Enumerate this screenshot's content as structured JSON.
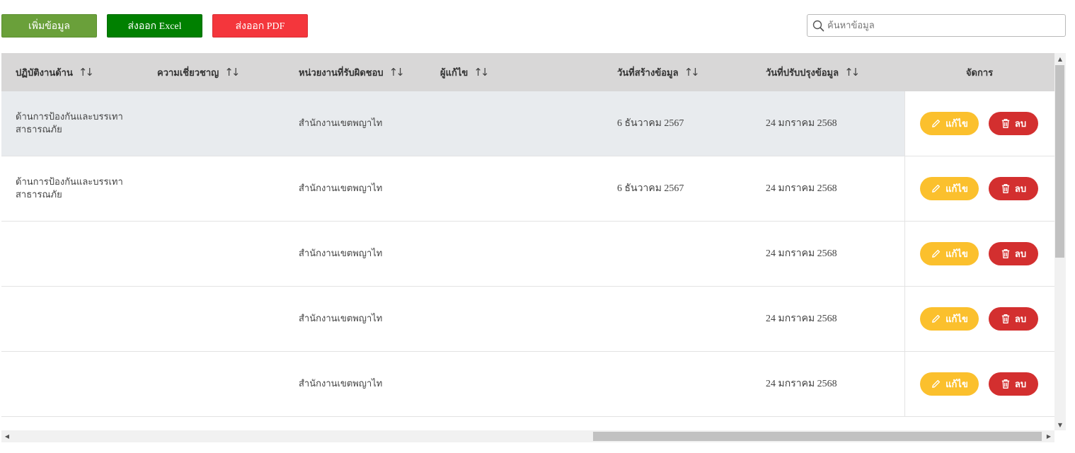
{
  "toolbar": {
    "add_label": "เพิ่มข้อมูล",
    "excel_label": "ส่งออก Excel",
    "pdf_label": "ส่งออก PDF"
  },
  "search": {
    "placeholder": "ค้นหาข้อมูล",
    "value": ""
  },
  "table": {
    "columns": {
      "topic": "ปฏิบัติงานด้าน",
      "expertise": "ความเชี่ยวชาญ",
      "unit": "หน่วยงานที่รับผิดชอบ",
      "editor": "ผู้แก้ไข",
      "created": "วันที่สร้างข้อมูล",
      "updated": "วันที่ปรับปรุงข้อมูล",
      "actions": "จัดการ"
    },
    "sort_glyph": "↑↓",
    "edit_label": "แก้ไข",
    "delete_label": "ลบ",
    "rows": [
      {
        "topic": "ด้านการป้องกันและบรรเทาสาธารณภัย",
        "expertise": "",
        "unit": "สำนักงานเขตพญาไท",
        "editor": "",
        "created": "6 ธันวาคม 2567",
        "updated": "24 มกราคม 2568"
      },
      {
        "topic": "ด้านการป้องกันและบรรเทาสาธารณภัย",
        "expertise": "",
        "unit": "สำนักงานเขตพญาไท",
        "editor": "",
        "created": "6 ธันวาคม 2567",
        "updated": "24 มกราคม 2568"
      },
      {
        "topic": "",
        "expertise": "",
        "unit": "สำนักงานเขตพญาไท",
        "editor": "",
        "created": "",
        "updated": "24 มกราคม 2568"
      },
      {
        "topic": "",
        "expertise": "",
        "unit": "สำนักงานเขตพญาไท",
        "editor": "",
        "created": "",
        "updated": "24 มกราคม 2568"
      },
      {
        "topic": "",
        "expertise": "",
        "unit": "สำนักงานเขตพญาไท",
        "editor": "",
        "created": "",
        "updated": "24 มกราคม 2568"
      }
    ]
  },
  "colors": {
    "add": "#6aa03a",
    "excel": "#008000",
    "pdf": "#f4363c",
    "edit": "#fbc02d",
    "delete": "#d32f2f",
    "header_bg": "#d8d7d7",
    "row_highlight": "#e8ebee"
  }
}
